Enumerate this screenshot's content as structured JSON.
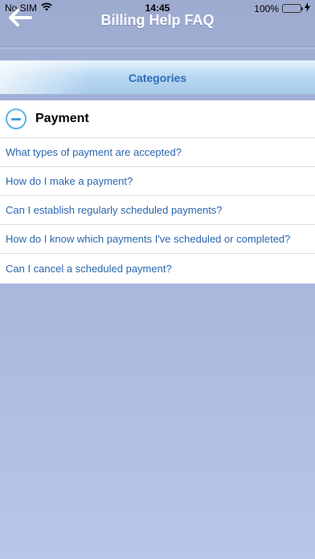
{
  "status_bar": {
    "carrier": "No SIM",
    "time": "14:45",
    "battery": "100%",
    "wifi_icon": "wifi-icon",
    "battery_icon": "battery-icon",
    "charging_icon": "charging-bolt-icon"
  },
  "header": {
    "title": "Billing Help FAQ",
    "back_icon": "arrow-left-icon"
  },
  "categories": {
    "label": "Categories"
  },
  "section": {
    "title": "Payment",
    "icon": "collapse-minus-icon",
    "accent_color": "#3f9fdc",
    "items": [
      {
        "label": "What types of payment are accepted?"
      },
      {
        "label": "How do I make a payment?"
      },
      {
        "label": "Can I establish regularly scheduled payments?"
      },
      {
        "label": "How do I know which payments I've scheduled or completed?"
      },
      {
        "label": "Can I cancel a scheduled payment?"
      }
    ]
  },
  "colors": {
    "link": "#2a66b0",
    "category_text": "#2d6eb8",
    "background": "#a7b4da"
  }
}
